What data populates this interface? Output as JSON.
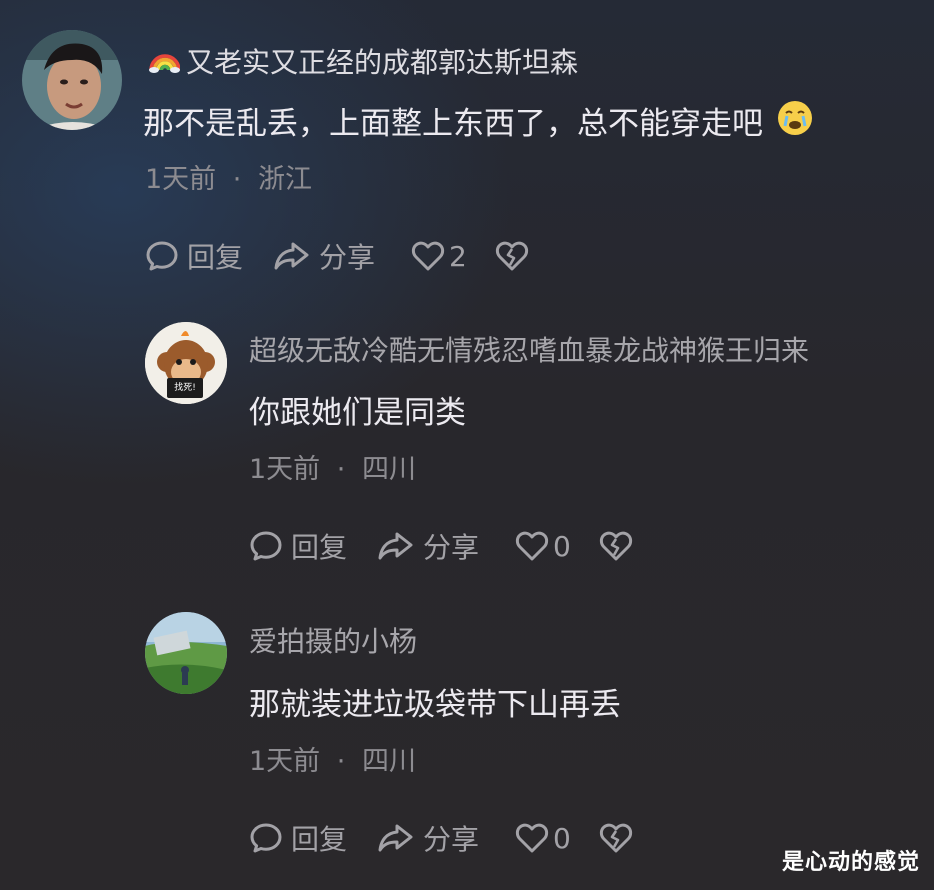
{
  "comments": [
    {
      "username": "又老实又正经的成都郭达斯坦森",
      "username_prefix_icon": "rainbow-emoji",
      "text": "那不是乱丢，上面整上东西了，总不能穿走吧",
      "trailing_emoji": "crying-face-emoji",
      "time": "1天前",
      "separator": "·",
      "location": "浙江",
      "reply_label": "回复",
      "share_label": "分享",
      "likes": "2",
      "avatar": "avatar-man-photo"
    },
    {
      "username": "超级无敌冷酷无情残忍嗜血暴龙战神猴王归来",
      "text": "你跟她们是同类",
      "time": "1天前",
      "separator": "·",
      "location": "四川",
      "reply_label": "回复",
      "share_label": "分享",
      "likes": "0",
      "avatar": "avatar-monkey-cartoon",
      "avatar_sign_text": "找死!"
    },
    {
      "username": "爱拍摄的小杨",
      "text": "那就装进垃圾袋带下山再丢",
      "time": "1天前",
      "separator": "·",
      "location": "四川",
      "reply_label": "回复",
      "share_label": "分享",
      "likes": "0",
      "avatar": "avatar-landscape-photo"
    }
  ],
  "watermark": "是心动的感觉",
  "colors": {
    "username": "#a7a6ab",
    "content": "#eceaf0",
    "meta": "#8d8c91",
    "action": "#a3a2a7"
  }
}
